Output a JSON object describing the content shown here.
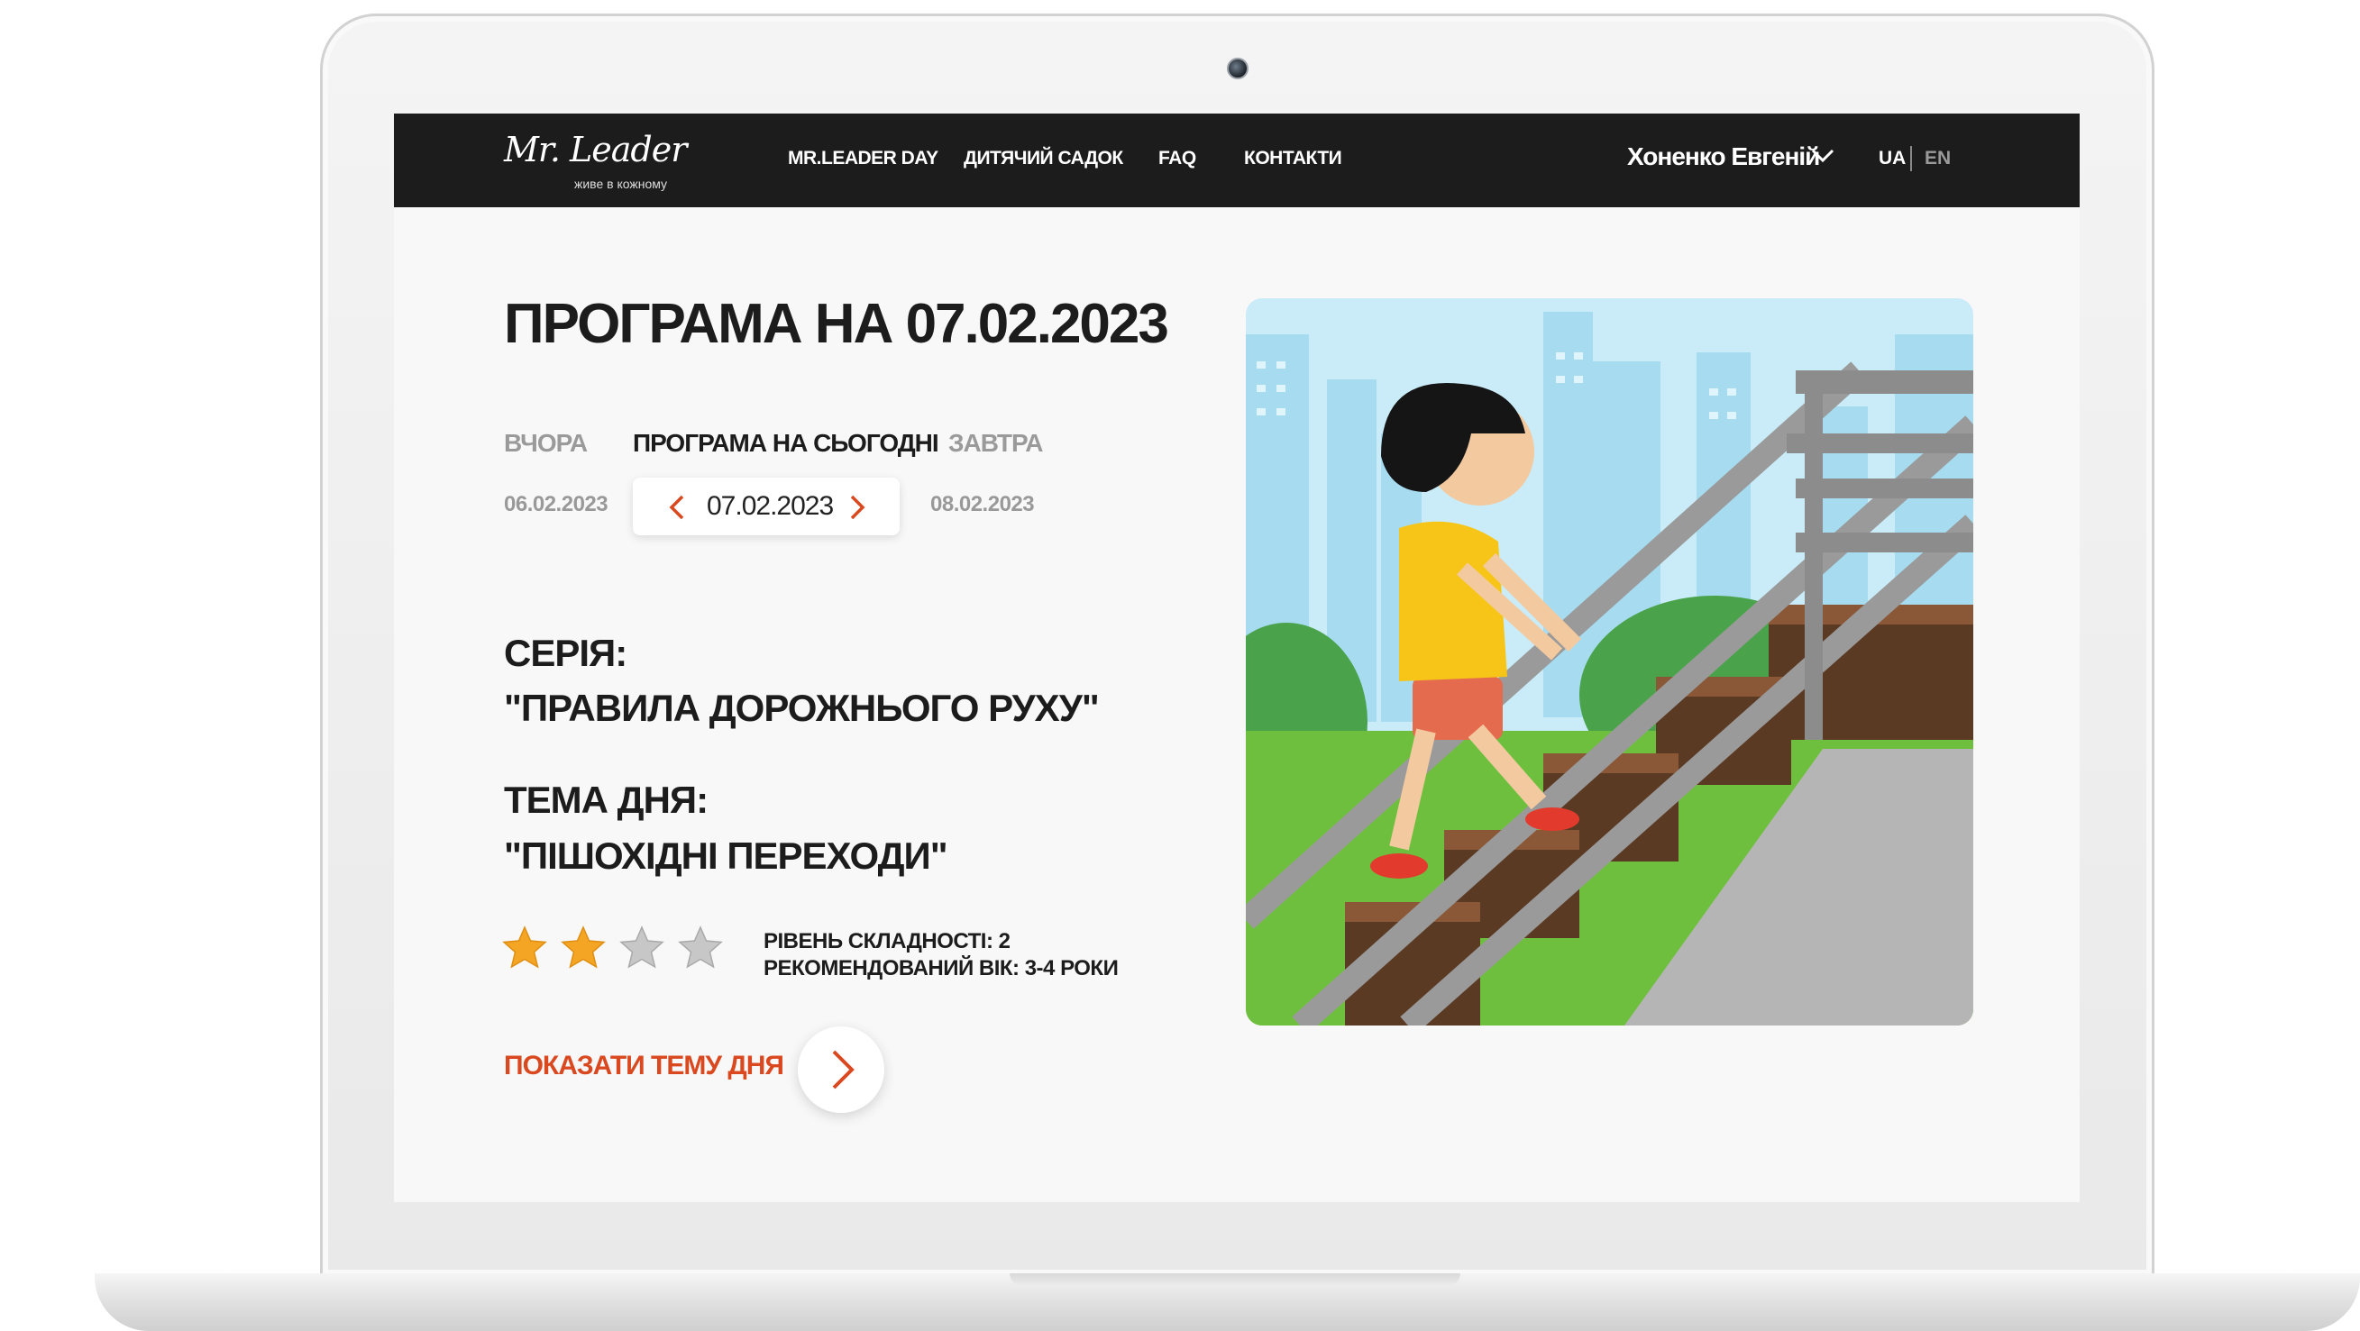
{
  "brand": {
    "logo_text": "Mr. Leader",
    "tagline": "живе в кожному"
  },
  "nav": {
    "links": [
      "MR.LEADER DAY",
      "ДИТЯЧИЙ САДОК",
      "FAQ",
      "КОНТАКТИ"
    ],
    "user_name": "Хоненко Евгеній",
    "languages": [
      "UA",
      "EN"
    ],
    "active_language": "UA"
  },
  "program": {
    "title": "ПРОГРАМА НА 07.02.2023",
    "days": {
      "prev_label": "ВЧОРА",
      "prev_date": "06.02.2023",
      "current_label": "ПРОГРАМА НА СЬОГОДНІ",
      "current_date": "07.02.2023",
      "next_label": "ЗАВТРА",
      "next_date": "08.02.2023"
    },
    "series_label": "СЕРІЯ:",
    "series_value": "\"ПРАВИЛА ДОРОЖНЬОГО РУХУ\"",
    "topic_label": "ТЕМА ДНЯ:",
    "topic_value": "\"ПІШОХІДНІ ПЕРЕХОДИ\"",
    "difficulty_text": "РІВЕНЬ СКЛАДНОСТІ: 2",
    "age_text": "РЕКОМЕНДОВАНИЙ ВІК: 3-4 РОКИ",
    "rating": {
      "filled": 2,
      "total": 4
    },
    "cta_label": "ПОКАЗАТИ ТЕМУ ДНЯ"
  },
  "colors": {
    "accent": "#d9481f",
    "header_bg": "#1c1c1c",
    "star_filled": "#f4a523",
    "star_empty": "#bdbdbd"
  },
  "icons": [
    "chevron-down-icon",
    "chevron-left-icon",
    "chevron-right-icon",
    "star-icon",
    "arrow-right-icon"
  ]
}
